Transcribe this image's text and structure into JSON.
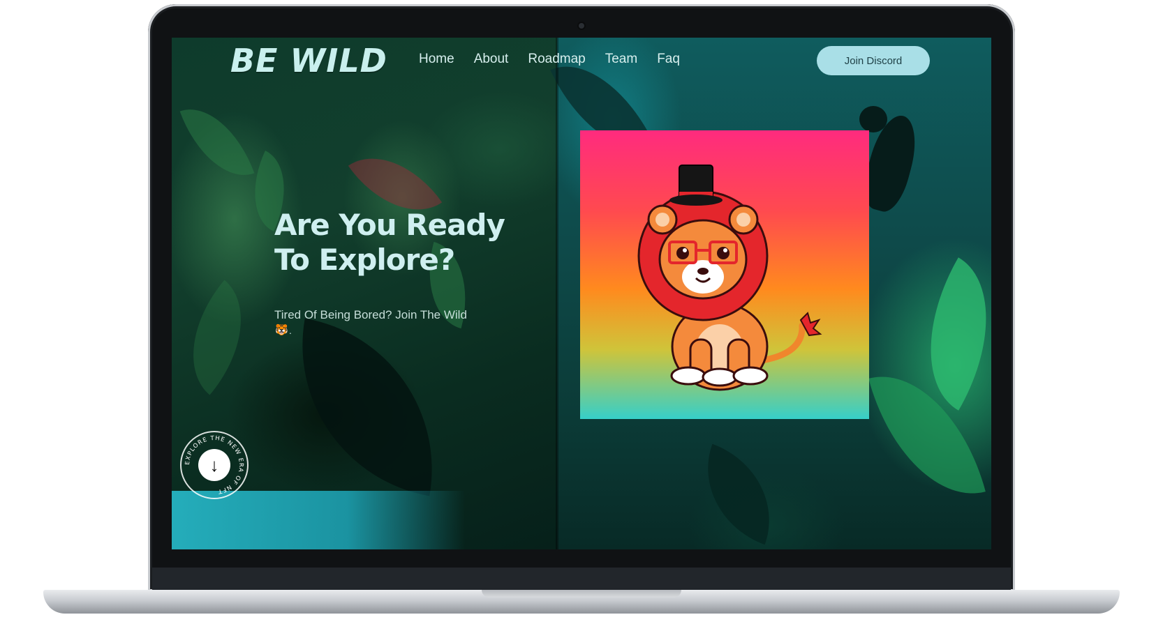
{
  "brand": {
    "logo_text": "BE WILD"
  },
  "nav": {
    "items": [
      {
        "label": "Home"
      },
      {
        "label": "About"
      },
      {
        "label": "Roadmap"
      },
      {
        "label": "Team"
      },
      {
        "label": "Faq"
      }
    ],
    "cta_label": "Join Discord"
  },
  "hero": {
    "title_line1": "Are You Ready",
    "title_line2": "To Explore?",
    "subtitle": "Tired Of Being Bored? Join The Wild",
    "emoji": "🐯",
    "trailing": "."
  },
  "scroll_badge": {
    "ring_text": "EXPLORE THE NEW ERA OF NFT",
    "icon": "arrow-down-icon"
  },
  "nft": {
    "icon": "lion-with-top-hat-icon"
  },
  "colors": {
    "logo": "#c9f0ee",
    "cta_bg": "#a9dfe7",
    "card_top": "#ff2b7e",
    "card_mid": "#ff8a1e",
    "card_bottom": "#36cfc9"
  }
}
